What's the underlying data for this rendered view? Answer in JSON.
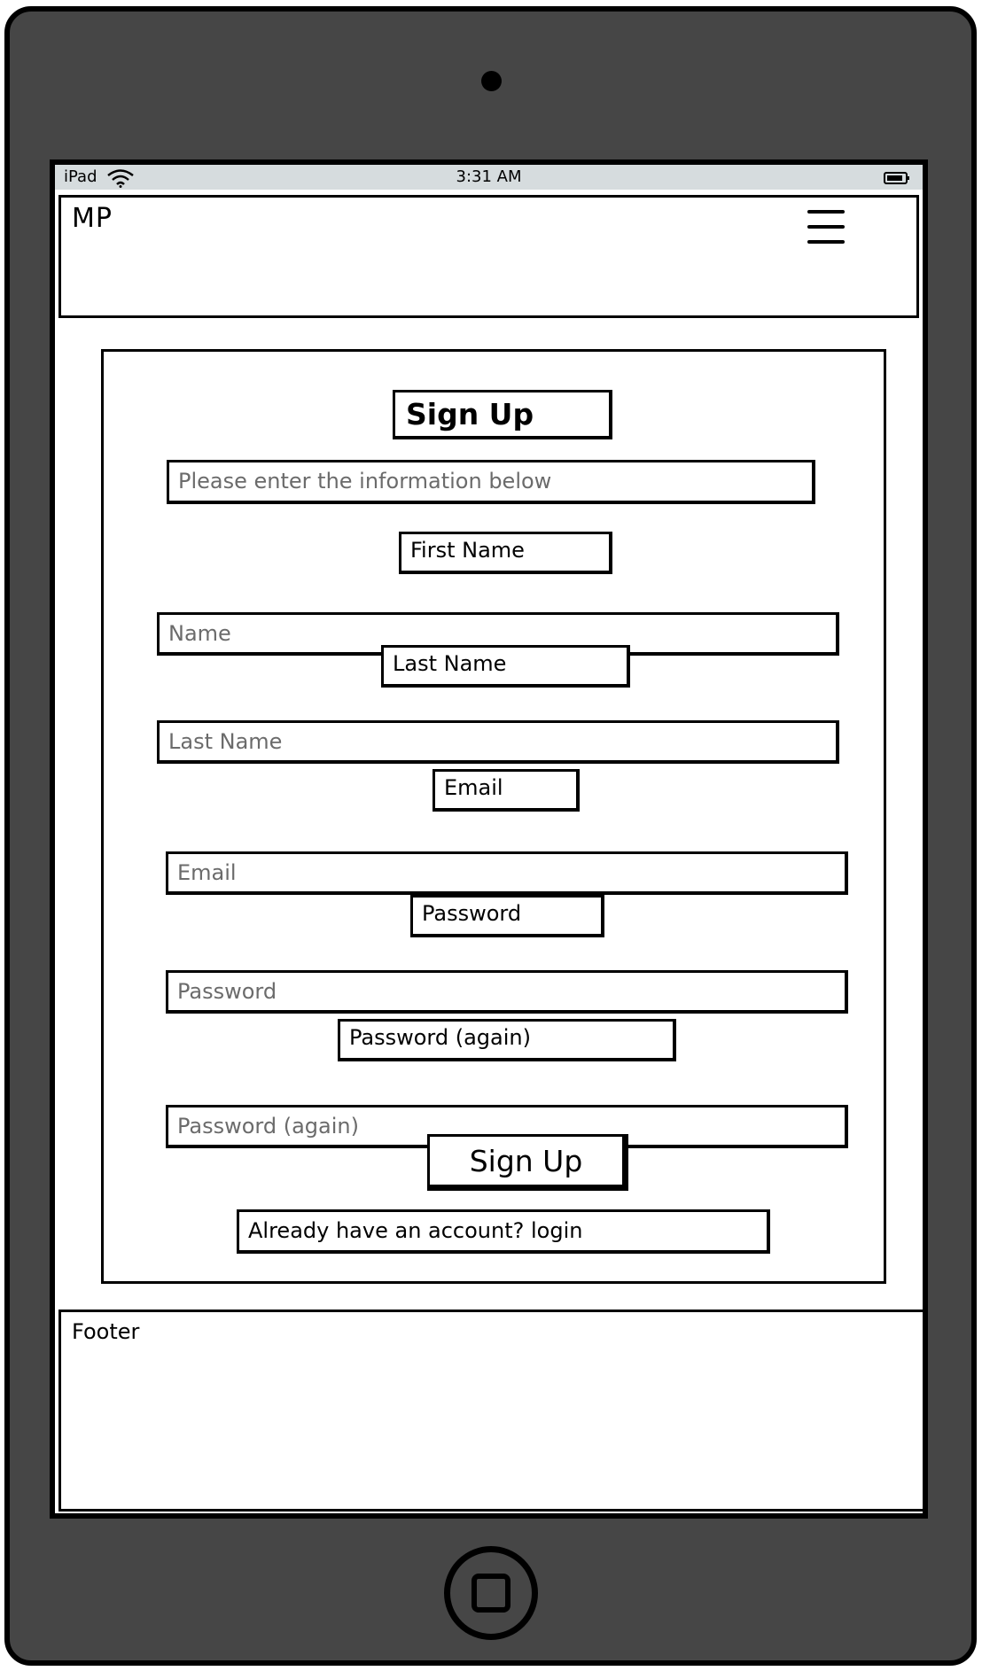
{
  "status_bar": {
    "device": "iPad",
    "time": "3:31 AM"
  },
  "header": {
    "logo": "MP",
    "menu_icon": "hamburger-menu-icon"
  },
  "signup": {
    "title": "Sign Up",
    "info_text": "Please enter the information below",
    "fields": [
      {
        "label": "First Name",
        "placeholder": "Name"
      },
      {
        "label": "Last Name",
        "placeholder": "Last Name"
      },
      {
        "label": "Email",
        "placeholder": "Email"
      },
      {
        "label": "Password",
        "placeholder": "Password"
      },
      {
        "label": "Password (again)",
        "placeholder": "Password (again)"
      }
    ],
    "button_label": "Sign Up",
    "login_link": "Already have an account? login"
  },
  "footer": {
    "text": "Footer"
  }
}
